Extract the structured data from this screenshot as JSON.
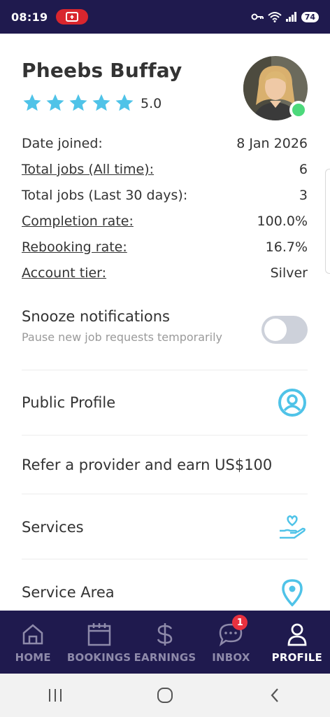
{
  "status_bar": {
    "time": "08:19",
    "battery": "74"
  },
  "profile": {
    "name": "Pheebs Buffay",
    "rating": "5.0",
    "stars": 5
  },
  "stats": [
    {
      "label": "Date joined:",
      "value": "8 Jan 2026",
      "underlined": false
    },
    {
      "label": "Total jobs (All time):",
      "value": "6",
      "underlined": true
    },
    {
      "label": "Total jobs (Last 30 days):",
      "value": "3",
      "underlined": false
    },
    {
      "label": "Completion rate:",
      "value": "100.0%",
      "underlined": true
    },
    {
      "label": "Rebooking rate:",
      "value": "16.7%",
      "underlined": true
    },
    {
      "label": "Account tier:",
      "value": "Silver",
      "underlined": true
    }
  ],
  "snooze": {
    "title": "Snooze notifications",
    "subtitle": "Pause new job requests temporarily",
    "enabled": false
  },
  "menu": [
    {
      "label": "Public Profile",
      "icon": "user-circle-icon"
    },
    {
      "label": "Refer a provider and earn US$100",
      "icon": ""
    },
    {
      "label": "Services",
      "icon": "hand-heart-icon"
    },
    {
      "label": "Service Area",
      "icon": "map-pin-icon"
    }
  ],
  "bottom_nav": [
    {
      "label": "HOME",
      "icon": "home-icon"
    },
    {
      "label": "BOOKINGS",
      "icon": "calendar-icon"
    },
    {
      "label": "EARNINGS",
      "icon": "dollar-icon"
    },
    {
      "label": "INBOX",
      "icon": "chat-icon",
      "badge": "1"
    },
    {
      "label": "PROFILE",
      "icon": "profile-icon",
      "active": true
    }
  ],
  "colors": {
    "accent": "#4fc3e8",
    "nav_bg": "#1f1a4e",
    "online": "#4cd97b",
    "badge": "#e8313f"
  }
}
